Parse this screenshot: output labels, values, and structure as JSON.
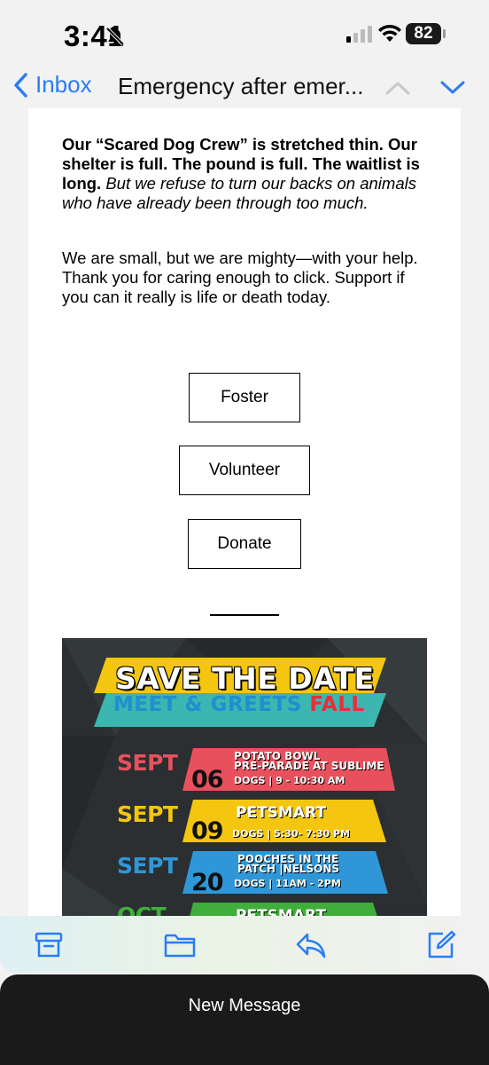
{
  "status": {
    "time": "3:41",
    "battery": "82"
  },
  "nav": {
    "back_label": "Inbox",
    "title": "Emergency after emer..."
  },
  "email": {
    "p1_bold": "Our “Scared Dog Crew” is stretched thin. Our shelter is full. The pound is full. The waitlist is long.",
    "p1_italic": "But we refuse to turn our backs on animals who have already been through too much.",
    "p2": "We are small, but we are mighty—with your help. Thank you for caring enough to click. Support if you can it really is life or death today.",
    "buttons": {
      "foster": "Foster",
      "volunteer": "Volunteer",
      "donate": "Donate"
    }
  },
  "flyer": {
    "title": "SAVE THE DATE",
    "subtitle_a": "MEET & GREETS",
    "subtitle_b": "FALL",
    "events": [
      {
        "month": "SEPT",
        "day": "06",
        "name1": "POTATO BOWL",
        "name2": "PRE-PARADE AT SUBLIME",
        "time": "DOGS | 9 - 10:30 AM",
        "color": "#e9505d",
        "month_color": "#e9505d"
      },
      {
        "month": "SEPT",
        "day": "09",
        "name1": "PETSMART",
        "name2": "",
        "time": "DOGS | 5:30- 7:30 PM",
        "color": "#f4c60f",
        "month_color": "#f4c60f"
      },
      {
        "month": "SEPT",
        "day": "20",
        "name1": "POOCHES IN THE",
        "name2": "PATCH |NELSONS",
        "time": "DOGS | 11AM - 2PM",
        "color": "#2f97d7",
        "month_color": "#2f97d7"
      },
      {
        "month": "OCT",
        "day": "",
        "name1": "PETSMART",
        "name2": "",
        "time": "",
        "color": "#3fae3a",
        "month_color": "#3fae3a"
      }
    ]
  },
  "compose": {
    "label": "New Message"
  }
}
